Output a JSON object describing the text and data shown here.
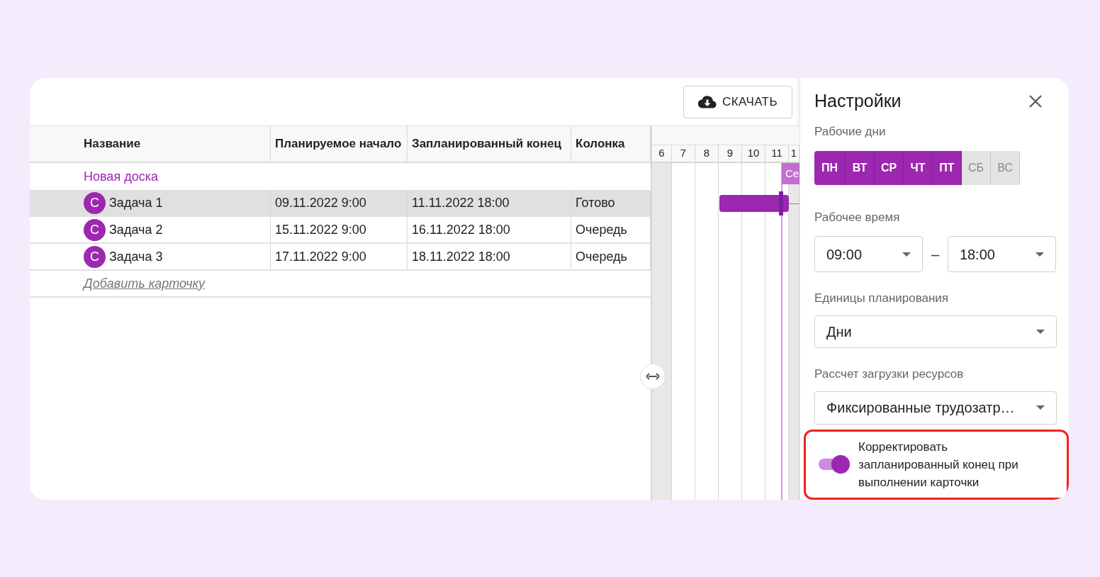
{
  "toolbar": {
    "download_button": "СКАЧАТЬ"
  },
  "table": {
    "columns": [
      "Название",
      "Планируемое начало",
      "Запланированный конец",
      "Колонка"
    ],
    "group": "Новая доска",
    "rows": [
      {
        "avatar": "С",
        "name": "Задача 1",
        "start": "09.11.2022 9:00",
        "end": "11.11.2022 18:00",
        "column": "Готово",
        "selected": true
      },
      {
        "avatar": "С",
        "name": "Задача 2",
        "start": "15.11.2022 9:00",
        "end": "16.11.2022 18:00",
        "column": "Очередь",
        "selected": false
      },
      {
        "avatar": "С",
        "name": "Задача 3",
        "start": "17.11.2022 9:00",
        "end": "18.11.2022 18:00",
        "column": "Очередь",
        "selected": false
      }
    ],
    "add_link": "Добавить карточку"
  },
  "gantt": {
    "days": [
      {
        "label": "6",
        "weekend": true
      },
      {
        "label": "7",
        "weekend": false
      },
      {
        "label": "8",
        "weekend": false
      },
      {
        "label": "9",
        "weekend": false
      },
      {
        "label": "10",
        "weekend": false
      },
      {
        "label": "11",
        "weekend": false
      },
      {
        "label": "1",
        "weekend": true
      }
    ],
    "today_label": "Се"
  },
  "settings": {
    "title": "Настройки",
    "work_days_label": "Рабочие дни",
    "days": [
      {
        "label": "ПН",
        "selected": true
      },
      {
        "label": "ВТ",
        "selected": true
      },
      {
        "label": "СР",
        "selected": true
      },
      {
        "label": "ЧТ",
        "selected": true
      },
      {
        "label": "ПТ",
        "selected": true
      },
      {
        "label": "СБ",
        "selected": false
      },
      {
        "label": "ВС",
        "selected": false
      }
    ],
    "work_time_label": "Рабочее время",
    "time_from": "09:00",
    "dash": "–",
    "time_to": "18:00",
    "units_label": "Единицы планирования",
    "units_value": "Дни",
    "load_label": "Рассчет загрузки ресурсов",
    "load_value": "Фиксированные трудозатр…",
    "toggle": {
      "label": "Корректировать запланированный конец при выполнении карточки",
      "on": true
    }
  }
}
